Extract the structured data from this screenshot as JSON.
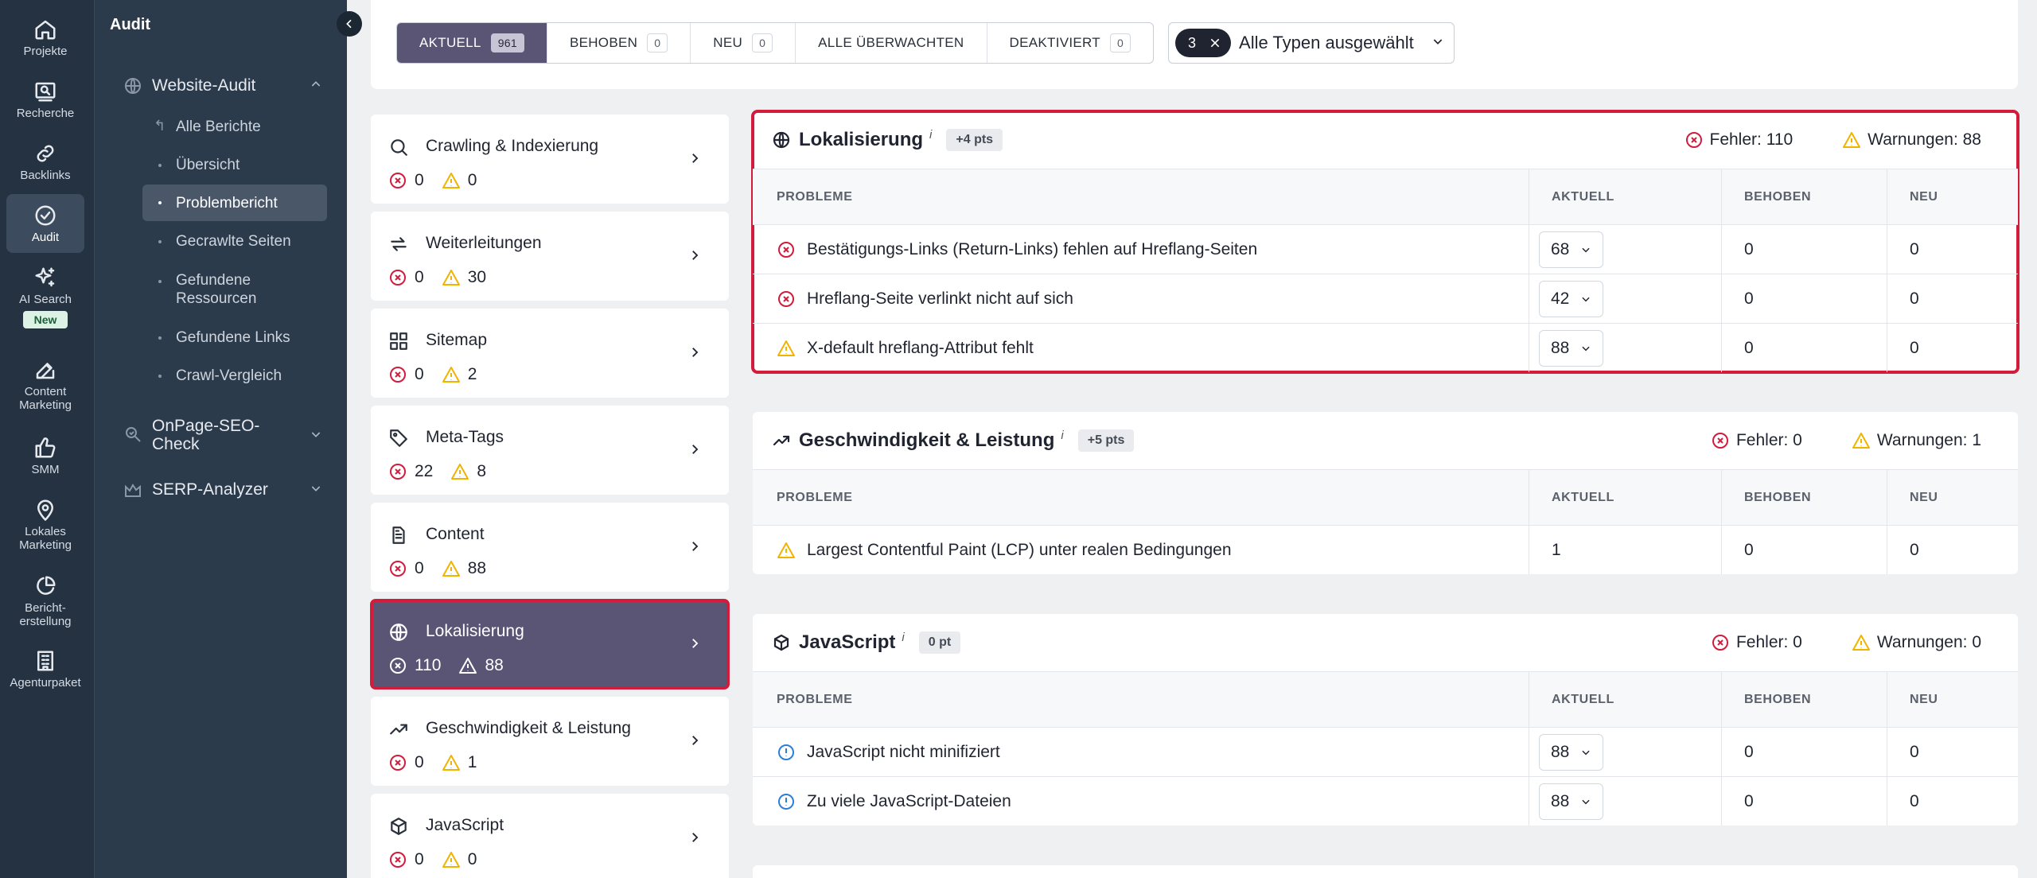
{
  "rail": {
    "items": [
      {
        "label": "Projekte",
        "icon": "home-icon"
      },
      {
        "label": "Recherche",
        "icon": "research-icon"
      },
      {
        "label": "Backlinks",
        "icon": "link-icon"
      },
      {
        "label": "Audit",
        "icon": "check-circle-icon"
      },
      {
        "label": "AI Search",
        "icon": "sparkle-icon",
        "badge": "New"
      },
      {
        "label": "Content Marketing",
        "icon": "edit-icon"
      },
      {
        "label": "SMM",
        "icon": "thumbs-up-icon"
      },
      {
        "label": "Lokales Marketing",
        "icon": "map-pin-icon"
      },
      {
        "label": "Bericht-erstellung",
        "icon": "pie-chart-icon"
      },
      {
        "label": "Agenturpaket",
        "icon": "building-icon"
      }
    ]
  },
  "sidebar": {
    "title": "Audit",
    "groups": {
      "website_audit": "Website-Audit",
      "onpage": "OnPage-SEO-Check",
      "serp": "SERP-Analyzer"
    },
    "items": [
      "Alle Berichte",
      "Übersicht",
      "Problembericht",
      "Gecrawlte Seiten",
      "Gefundene Ressourcen",
      "Gefundene Links",
      "Crawl-Vergleich"
    ]
  },
  "filters": {
    "tabs": [
      {
        "label": "AKTUELL",
        "count": "961"
      },
      {
        "label": "BEHOBEN",
        "count": "0"
      },
      {
        "label": "NEU",
        "count": "0"
      },
      {
        "label": "ALLE ÜBERWACHTEN",
        "count": ""
      },
      {
        "label": "DEAKTIVIERT",
        "count": "0"
      }
    ],
    "types_count": "3",
    "types_label": "Alle Typen ausgewählt"
  },
  "categories": [
    {
      "name": "Crawling & Indexierung",
      "errors": "0",
      "warnings": "0"
    },
    {
      "name": "Weiterleitungen",
      "errors": "0",
      "warnings": "30"
    },
    {
      "name": "Sitemap",
      "errors": "0",
      "warnings": "2"
    },
    {
      "name": "Meta-Tags",
      "errors": "22",
      "warnings": "8"
    },
    {
      "name": "Content",
      "errors": "0",
      "warnings": "88"
    },
    {
      "name": "Lokalisierung",
      "errors": "110",
      "warnings": "88"
    },
    {
      "name": "Geschwindigkeit & Leistung",
      "errors": "0",
      "warnings": "1"
    },
    {
      "name": "JavaScript",
      "errors": "0",
      "warnings": "0"
    }
  ],
  "columns": {
    "problems": "PROBLEME",
    "current": "AKTUELL",
    "fixed": "BEHOBEN",
    "new": "NEU"
  },
  "sections": [
    {
      "title": "Lokalisierung",
      "info": "i",
      "pts": "+4 pts",
      "errors": "Fehler: 110",
      "warnings": "Warnungen: 88",
      "rows": [
        {
          "text": "Bestätigungs-Links (Return-Links) fehlen auf Hreflang-Seiten",
          "current": "68",
          "fixed": "0",
          "new": "0"
        },
        {
          "text": "Hreflang-Seite verlinkt nicht auf sich",
          "current": "42",
          "fixed": "0",
          "new": "0"
        },
        {
          "text": "X-default hreflang-Attribut fehlt",
          "current": "88",
          "fixed": "0",
          "new": "0"
        }
      ]
    },
    {
      "title": "Geschwindigkeit & Leistung",
      "info": "i",
      "pts": "+5 pts",
      "errors": "Fehler: 0",
      "warnings": "Warnungen: 1",
      "rows": [
        {
          "text": "Largest Contentful Paint (LCP) unter realen Bedingungen",
          "current": "1",
          "fixed": "0",
          "new": "0"
        }
      ]
    },
    {
      "title": "JavaScript",
      "info": "i",
      "pts": "0 pt",
      "errors": "Fehler: 0",
      "warnings": "Warnungen: 0",
      "rows": [
        {
          "text": "JavaScript nicht minifiziert",
          "current": "88",
          "fixed": "0",
          "new": "0"
        },
        {
          "text": "Zu viele JavaScript-Dateien",
          "current": "88",
          "fixed": "0",
          "new": "0"
        }
      ]
    }
  ],
  "colors": {
    "error": "#d21c3c",
    "warning": "#f0b400",
    "notice": "#2b7fd6",
    "accent": "#5a5475"
  }
}
